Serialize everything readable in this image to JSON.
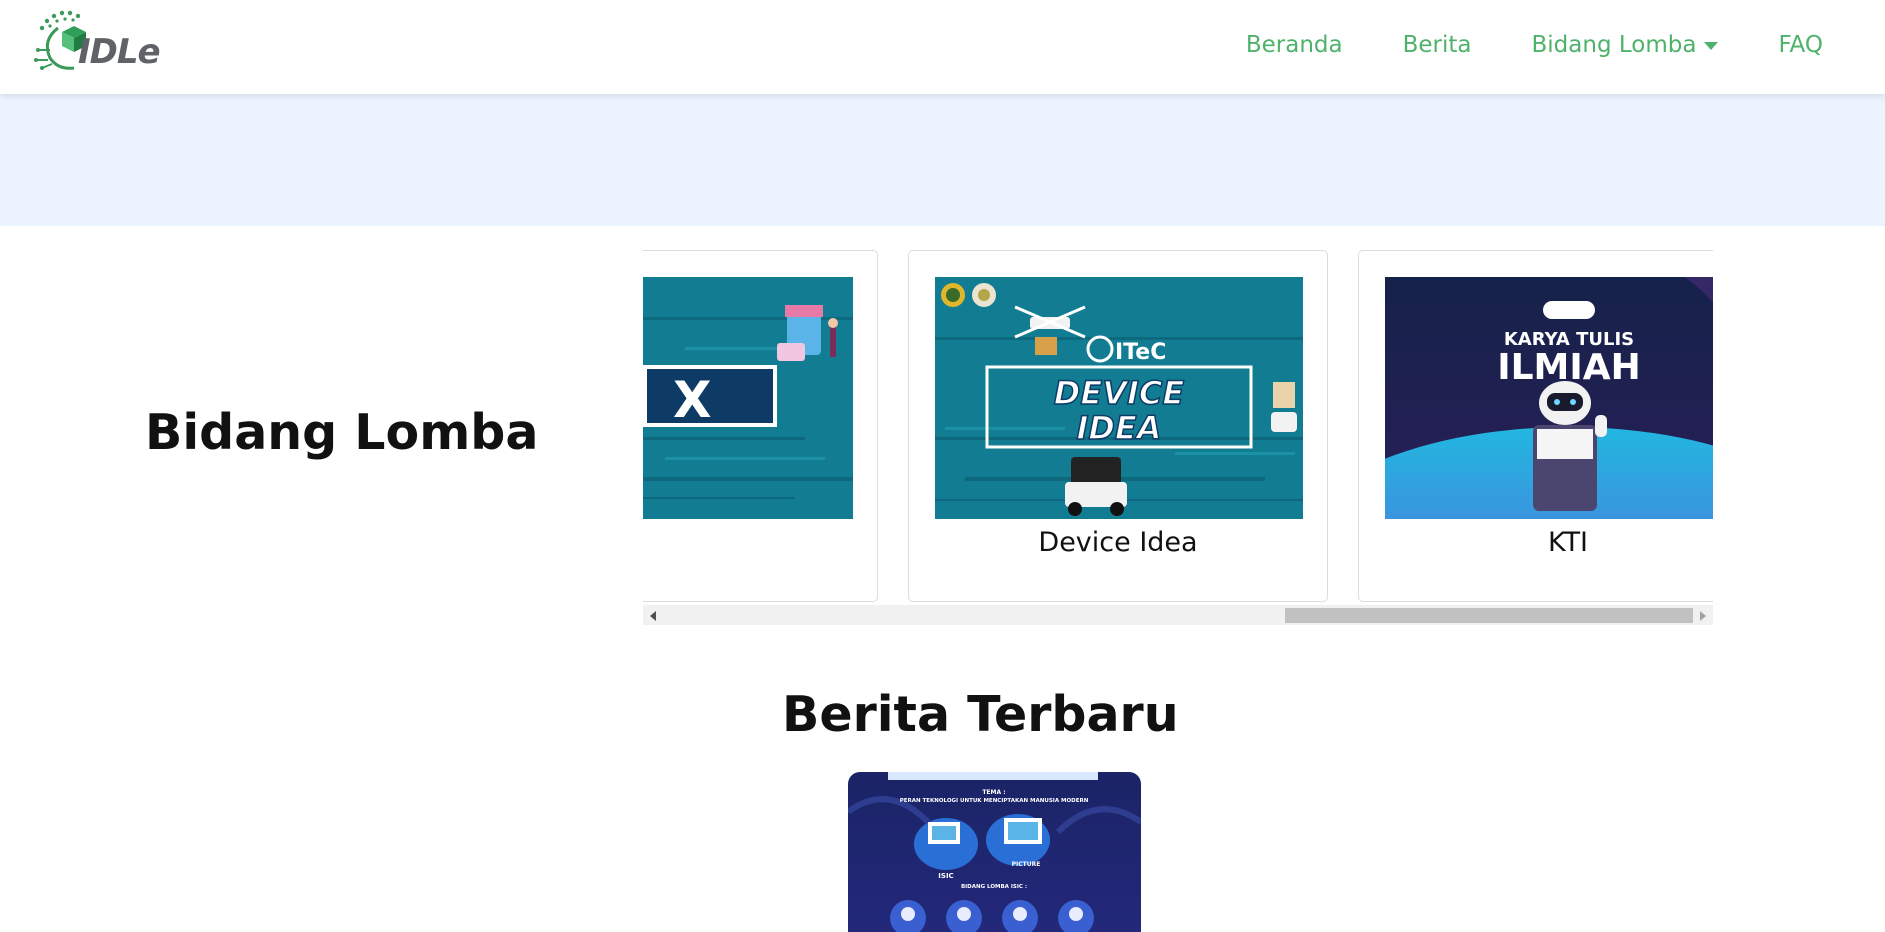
{
  "brand": {
    "name": "IDLe",
    "icon": "idle-logo"
  },
  "nav": {
    "items": [
      {
        "label": "Beranda"
      },
      {
        "label": "Berita"
      },
      {
        "label": "Bidang Lomba",
        "has_dropdown": true
      },
      {
        "label": "FAQ"
      }
    ]
  },
  "competitions": {
    "title": "Bidang Lomba",
    "cards": [
      {
        "label": "",
        "image_text": "X"
      },
      {
        "label": "Device Idea",
        "image_text": [
          "DEVICE",
          "IDEA",
          "ITeC"
        ]
      },
      {
        "label": "KTI",
        "image_text": [
          "KARYA TULIS",
          "ILMIAH"
        ]
      }
    ]
  },
  "news": {
    "title": "Berita Terbaru",
    "poster_text": [
      "TEMA :",
      "PERAN TEKNOLOGI UNTUK MENCIPTAKAN MANUSIA MODERN",
      "ISIC",
      "PICTURE",
      "BIDANG LOMBA ISIC :"
    ]
  },
  "colors": {
    "accent_green": "#4fb26a",
    "hero_band": "#ebf3ff",
    "card_teal": "#127d92",
    "kti_navy": "#15224a"
  }
}
